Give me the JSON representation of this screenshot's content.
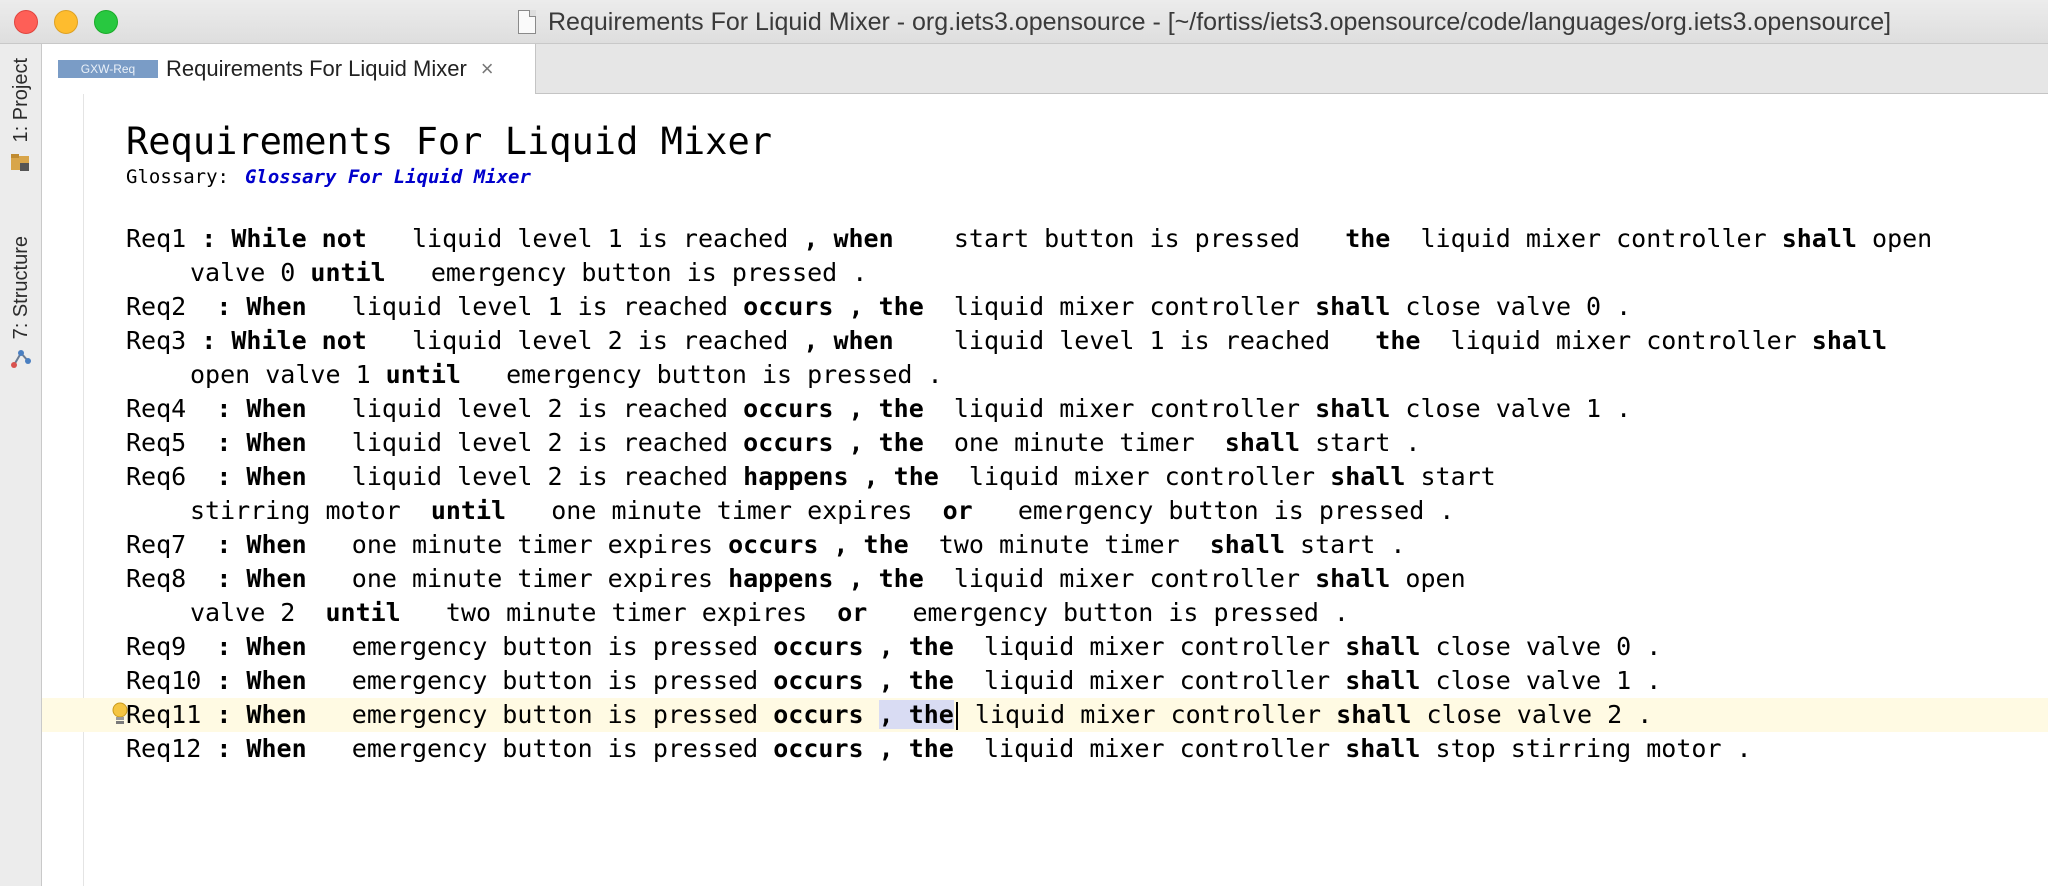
{
  "window": {
    "title": "Requirements For Liquid Mixer - org.iets3.opensource - [~/fortiss/iets3.opensource/code/languages/org.iets3.opensource]"
  },
  "sidebar": {
    "project_tab": "1: Project",
    "structure_tab": "7: Structure"
  },
  "tab": {
    "badge": "GXW-Req",
    "label": "Requirements For Liquid Mixer",
    "close": "×"
  },
  "document": {
    "title": "Requirements For Liquid Mixer",
    "glossary_label": "Glossary:",
    "glossary_link": "Glossary For Liquid Mixer"
  },
  "requirements": {
    "req1": {
      "id": "Req1 ",
      "sep": ": ",
      "k1": "While not",
      "c1": "   liquid level 1 is reached ",
      "k2": ", when",
      "c2": "    start button is pressed   ",
      "k3": "the",
      "c3": "  liquid mixer controller ",
      "k4": "shall",
      "c4": " open",
      "cont_a": "valve 0 ",
      "cont_k": "until",
      "cont_b": "   emergency button is pressed ."
    },
    "req2": {
      "id": "Req2  ",
      "sep": ": ",
      "k1": "When",
      "c1": "   liquid level 1 is reached ",
      "k2": "occurs , the",
      "c2": "  liquid mixer controller ",
      "k3": "shall",
      "c3": " close valve 0 ."
    },
    "req3": {
      "id": "Req3 ",
      "sep": ": ",
      "k1": "While not",
      "c1": "   liquid level 2 is reached ",
      "k2": ", when",
      "c2": "    liquid level 1 is reached   ",
      "k3": "the",
      "c3": "  liquid mixer controller ",
      "k4": "shall",
      "cont_a": "open valve 1 ",
      "cont_k": "until",
      "cont_b": "   emergency button is pressed ."
    },
    "req4": {
      "id": "Req4  ",
      "sep": ": ",
      "k1": "When",
      "c1": "   liquid level 2 is reached ",
      "k2": "occurs , the",
      "c2": "  liquid mixer controller ",
      "k3": "shall",
      "c3": " close valve 1 ."
    },
    "req5": {
      "id": "Req5  ",
      "sep": ": ",
      "k1": "When",
      "c1": "   liquid level 2 is reached ",
      "k2": "occurs , the",
      "c2": "  one minute timer  ",
      "k3": "shall",
      "c3": " start ."
    },
    "req6": {
      "id": "Req6  ",
      "sep": ": ",
      "k1": "When",
      "c1": "   liquid level 2 is reached ",
      "k2": "happens , the",
      "c2": "  liquid mixer controller ",
      "k3": "shall",
      "c3": " start",
      "cont_a": "stirring motor  ",
      "cont_k": "until",
      "cont_b": "   one minute timer expires  ",
      "cont_k2": "or",
      "cont_c": "   emergency button is pressed ."
    },
    "req7": {
      "id": "Req7  ",
      "sep": ": ",
      "k1": "When",
      "c1": "   one minute timer expires ",
      "k2": "occurs , the",
      "c2": "  two minute timer  ",
      "k3": "shall",
      "c3": " start ."
    },
    "req8": {
      "id": "Req8  ",
      "sep": ": ",
      "k1": "When",
      "c1": "   one minute timer expires ",
      "k2": "happens , the",
      "c2": "  liquid mixer controller ",
      "k3": "shall",
      "c3": " open",
      "cont_a": "valve 2  ",
      "cont_k": "until",
      "cont_b": "   two minute timer expires  ",
      "cont_k2": "or",
      "cont_c": "   emergency button is pressed ."
    },
    "req9": {
      "id": "Req9  ",
      "sep": ": ",
      "k1": "When",
      "c1": "   emergency button is pressed ",
      "k2": "occurs , the",
      "c2": "  liquid mixer controller ",
      "k3": "shall",
      "c3": " close valve 0 ."
    },
    "req10": {
      "id": "Req10 ",
      "sep": ": ",
      "k1": "When",
      "c1": "   emergency button is pressed ",
      "k2": "occurs , the",
      "c2": "  liquid mixer controller ",
      "k3": "shall",
      "c3": " close valve 1 ."
    },
    "req11": {
      "id": "Req11 ",
      "sep": ": ",
      "k1": "When",
      "c1": "   emergency button is pressed ",
      "k2": "occurs ",
      "k2sel": ", the",
      "c2": " liquid mixer controller ",
      "k3": "shall",
      "c3": " close valve 2 ."
    },
    "req12": {
      "id": "Req12 ",
      "sep": ": ",
      "k1": "When",
      "c1": "   emergency button is pressed ",
      "k2": "occurs , the",
      "c2": "  liquid mixer controller ",
      "k3": "shall",
      "c3": " stop stirring motor ."
    }
  },
  "colors": {
    "link": "#0000cc",
    "current_line": "#fffae3",
    "selection": "#d9dcf3"
  }
}
